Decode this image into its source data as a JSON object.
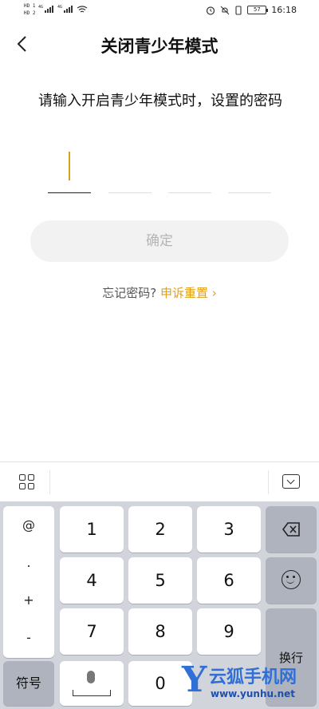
{
  "status_bar": {
    "sim1": "HD 1",
    "sim2": "HD 2",
    "net1": "4G",
    "net2": "4G",
    "battery": "57",
    "time": "16:18"
  },
  "header": {
    "back_icon": "chevron-left-icon",
    "title": "关闭青少年模式"
  },
  "prompt": "请输入开启青少年模式时，设置的密码",
  "code_input": {
    "length": 4,
    "filled": 0,
    "caret_color": "#d6a21a"
  },
  "confirm_label": "确定",
  "forgot": {
    "question": "忘记密码?",
    "link": "申诉重置",
    "link_color": "#e2a01c"
  },
  "keyboard": {
    "toolbar": {
      "left_icon": "grid-icon",
      "right_icon": "hide-keyboard-icon"
    },
    "symbols": [
      "@",
      ".",
      "+",
      "-"
    ],
    "digits": [
      "1",
      "2",
      "3",
      "4",
      "5",
      "6",
      "7",
      "8",
      "9"
    ],
    "zero": "0",
    "symbol_key": "符号",
    "enter_key": "换行",
    "delete_icon": "backspace-icon",
    "emoji_icon": "smile-icon",
    "space_icon": "mic-icon"
  },
  "watermark": {
    "letter": "Y",
    "text": "云狐手机网",
    "url": "www.yunhu.net"
  }
}
